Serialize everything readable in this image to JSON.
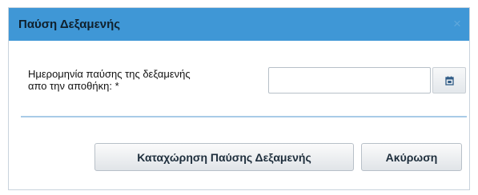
{
  "dialog": {
    "title": "Παύση Δεξαμενής",
    "close_symbol": "×"
  },
  "form": {
    "date_label_line1": "Ημερομηνία παύσης της δεξαμενής",
    "date_label_line2": "απο την αποθήκη: *",
    "date_value": "",
    "calendar_icon": "calendar-icon"
  },
  "actions": {
    "save_label": "Καταχώρηση Παύσης Δεξαμενής",
    "cancel_label": "Ακύρωση"
  },
  "colors": {
    "titlebar": "#3f97d6",
    "divider": "#a9cbe7"
  }
}
